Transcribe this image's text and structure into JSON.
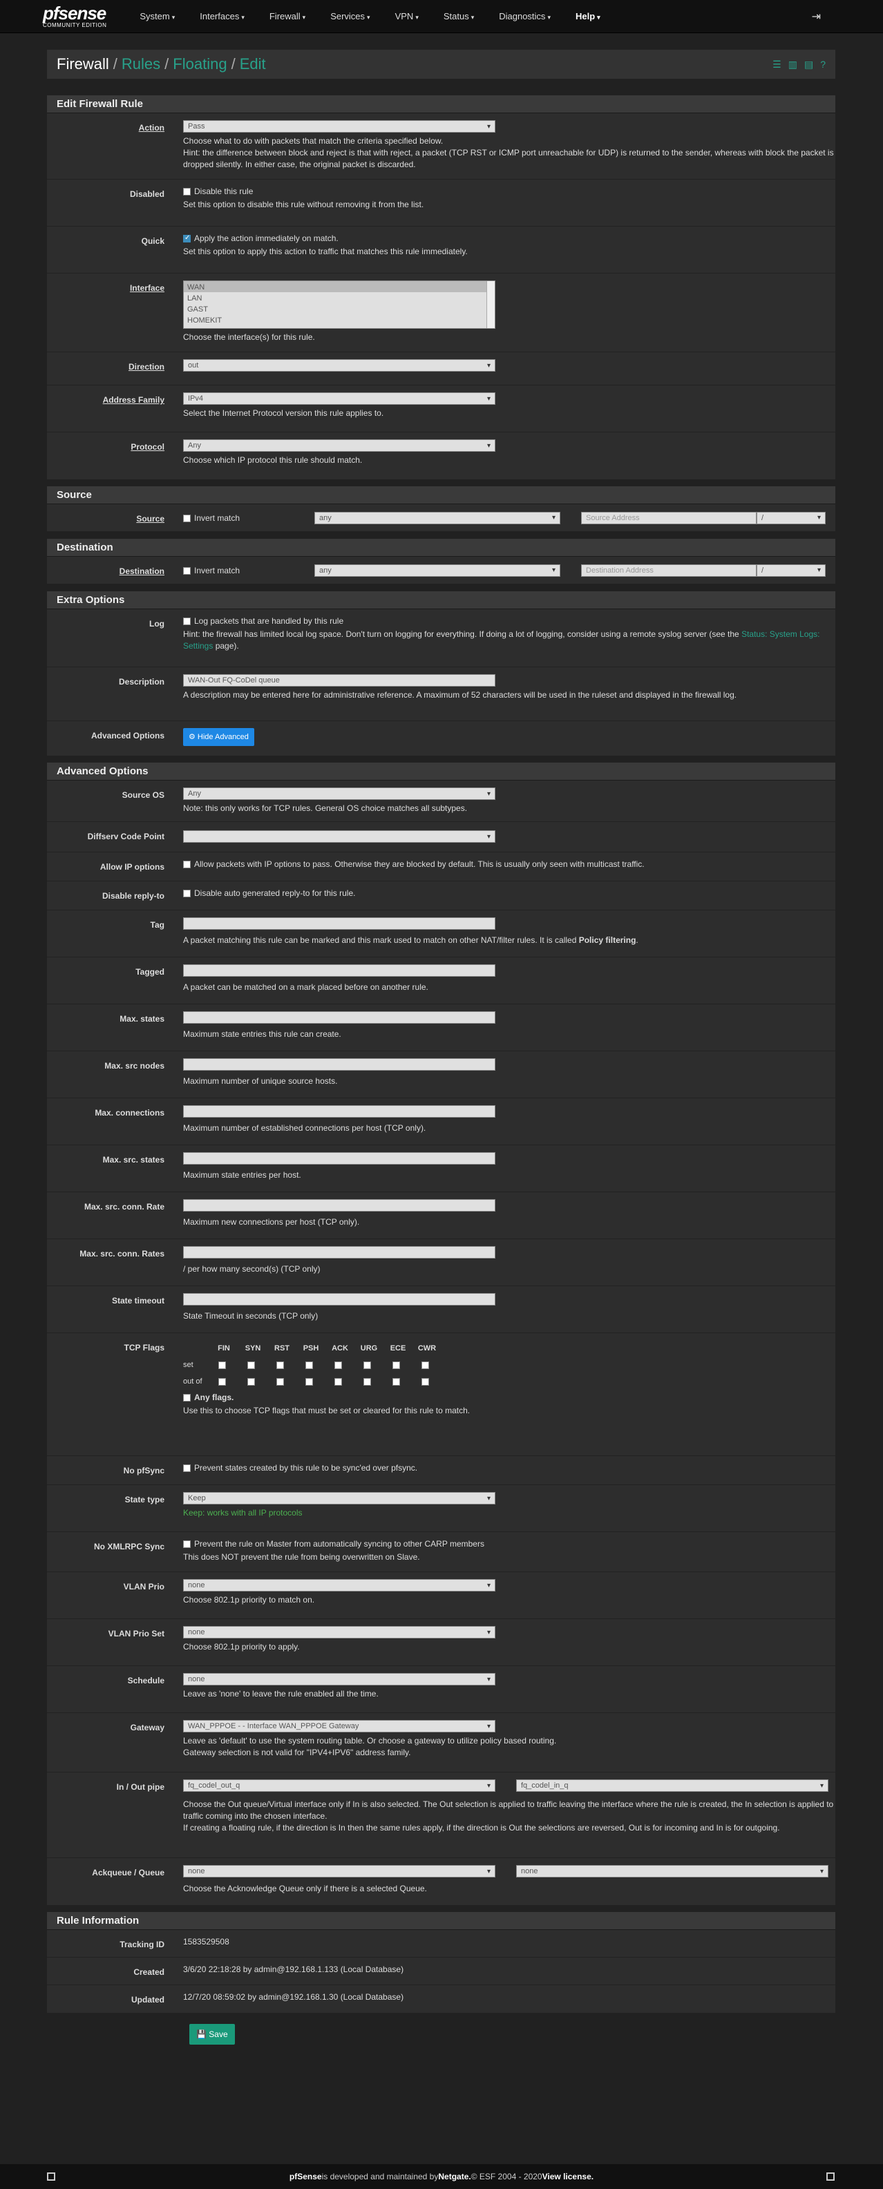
{
  "nav": {
    "brand_logo": "pfsense",
    "brand_edition": "COMMUNITY EDITION",
    "items": [
      "System",
      "Interfaces",
      "Firewall",
      "Services",
      "VPN",
      "Status",
      "Diagnostics",
      "Help"
    ],
    "logout_icon": "sign-out-icon"
  },
  "breadcrumb": {
    "firewall": "Firewall",
    "rules": "Rules",
    "floating": "Floating",
    "edit": "Edit",
    "sep": "/"
  },
  "panels": {
    "edit": "Edit Firewall Rule",
    "source": "Source",
    "destination": "Destination",
    "extra": "Extra Options",
    "advanced": "Advanced Options",
    "info": "Rule Information"
  },
  "action": {
    "label": "Action",
    "value": "Pass",
    "help1": "Choose what to do with packets that match the criteria specified below.",
    "help2": "Hint: the difference between block and reject is that with reject, a packet (TCP RST or ICMP port unreachable for UDP) is returned to the sender, whereas with block the packet is dropped silently. In either case, the original packet is discarded."
  },
  "disabled": {
    "label": "Disabled",
    "check": "Disable this rule",
    "help": "Set this option to disable this rule without removing it from the list."
  },
  "quick": {
    "label": "Quick",
    "check": "Apply the action immediately on match.",
    "help": "Set this option to apply this action to traffic that matches this rule immediately."
  },
  "interface": {
    "label": "Interface",
    "options": [
      "WAN",
      "LAN",
      "GAST",
      "HOMEKIT"
    ],
    "help": "Choose the interface(s) for this rule."
  },
  "direction": {
    "label": "Direction",
    "value": "out"
  },
  "family": {
    "label": "Address Family",
    "value": "IPv4",
    "help": "Select the Internet Protocol version this rule applies to."
  },
  "protocol": {
    "label": "Protocol",
    "value": "Any",
    "help": "Choose which IP protocol this rule should match."
  },
  "source": {
    "label": "Source",
    "invert": "Invert match",
    "type": "any",
    "placeholder": "Source Address",
    "slash": "/"
  },
  "destination": {
    "label": "Destination",
    "invert": "Invert match",
    "type": "any",
    "placeholder": "Destination Address",
    "slash": "/"
  },
  "log": {
    "label": "Log",
    "check": "Log packets that are handled by this rule",
    "help_a": "Hint: the firewall has limited local log space. Don't turn on logging for everything. If doing a lot of logging, consider using a remote syslog server (see the ",
    "help_link": "Status: System Logs: Settings",
    "help_b": " page)."
  },
  "description": {
    "label": "Description",
    "value": "WAN-Out FQ-CoDel queue",
    "help": "A description may be entered here for administrative reference. A maximum of 52 characters will be used in the ruleset and displayed in the firewall log."
  },
  "adv_options": {
    "label": "Advanced Options",
    "button": "Hide Advanced"
  },
  "adv": {
    "source_os": {
      "label": "Source OS",
      "value": "Any",
      "help": "Note: this only works for TCP rules. General OS choice matches all subtypes."
    },
    "diffserv": {
      "label": "Diffserv Code Point",
      "value": ""
    },
    "allow_ip": {
      "label": "Allow IP options",
      "check": "Allow packets with IP options to pass. Otherwise they are blocked by default. This is usually only seen with multicast traffic."
    },
    "disable_reply": {
      "label": "Disable reply-to",
      "check": "Disable auto generated reply-to for this rule."
    },
    "tag": {
      "label": "Tag",
      "help_a": "A packet matching this rule can be marked and this mark used to match on other NAT/filter rules. It is called ",
      "help_b": "Policy filtering",
      "help_c": "."
    },
    "tagged": {
      "label": "Tagged",
      "help": "A packet can be matched on a mark placed before on another rule."
    },
    "max_states": {
      "label": "Max. states",
      "help": "Maximum state entries this rule can create."
    },
    "max_src_nodes": {
      "label": "Max. src nodes",
      "help": "Maximum number of unique source hosts."
    },
    "max_conn": {
      "label": "Max. connections",
      "help": "Maximum number of established connections per host (TCP only)."
    },
    "max_src_states": {
      "label": "Max. src. states",
      "help": "Maximum state entries per host."
    },
    "max_src_conn_rate": {
      "label": "Max. src. conn. Rate",
      "help": "Maximum new connections per host (TCP only)."
    },
    "max_src_conn_rates": {
      "label": "Max. src. conn. Rates",
      "help": "/ per how many second(s) (TCP only)"
    },
    "state_timeout": {
      "label": "State timeout",
      "help": "State Timeout in seconds (TCP only)"
    },
    "tcp_flags": {
      "label": "TCP Flags",
      "flags": [
        "FIN",
        "SYN",
        "RST",
        "PSH",
        "ACK",
        "URG",
        "ECE",
        "CWR"
      ],
      "set": "set",
      "outof": "out of",
      "any": "Any flags.",
      "help": "Use this to choose TCP flags that must be set or cleared for this rule to match."
    },
    "no_pfsync": {
      "label": "No pfSync",
      "check": "Prevent states created by this rule to be sync'ed over pfsync."
    },
    "state_type": {
      "label": "State type",
      "value": "Keep",
      "help": "Keep: works with all IP protocols"
    },
    "no_xmlrpc": {
      "label": "No XMLRPC Sync",
      "check": "Prevent the rule on Master from automatically syncing to other CARP members",
      "help": "This does NOT prevent the rule from being overwritten on Slave."
    },
    "vlan_prio": {
      "label": "VLAN Prio",
      "value": "none",
      "help": "Choose 802.1p priority to match on."
    },
    "vlan_prio_set": {
      "label": "VLAN Prio Set",
      "value": "none",
      "help": "Choose 802.1p priority to apply."
    },
    "schedule": {
      "label": "Schedule",
      "value": "none",
      "help": "Leave as 'none' to leave the rule enabled all the time."
    },
    "gateway": {
      "label": "Gateway",
      "value": "WAN_PPPOE - - Interface WAN_PPPOE Gateway",
      "help1": "Leave as 'default' to use the system routing table. Or choose a gateway to utilize policy based routing.",
      "help2": "Gateway selection is not valid for \"IPV4+IPV6\" address family."
    },
    "pipe": {
      "label": "In / Out pipe",
      "out": "fq_codel_out_q",
      "in": "fq_codel_in_q",
      "help1": "Choose the Out queue/Virtual interface only if In is also selected. The Out selection is applied to traffic leaving the interface where the rule is created, the In selection is applied to traffic coming into the chosen interface.",
      "help2": "If creating a floating rule, if the direction is In then the same rules apply, if the direction is Out the selections are reversed, Out is for incoming and In is for outgoing."
    },
    "ackqueue": {
      "label": "Ackqueue / Queue",
      "ack": "none",
      "queue": "none",
      "help": "Choose the Acknowledge Queue only if there is a selected Queue."
    }
  },
  "info": {
    "tracking": {
      "label": "Tracking ID",
      "value": "1583529508"
    },
    "created": {
      "label": "Created",
      "value": "3/6/20 22:18:28 by admin@192.168.1.133 (Local Database)"
    },
    "updated": {
      "label": "Updated",
      "value": "12/7/20 08:59:02 by admin@192.168.1.30 (Local Database)"
    }
  },
  "save": "Save",
  "footer": {
    "a": "pfSense",
    "b": " is developed and maintained by ",
    "c": "Netgate.",
    "d": " © ESF 2004 - 2020 ",
    "e": "View license."
  }
}
